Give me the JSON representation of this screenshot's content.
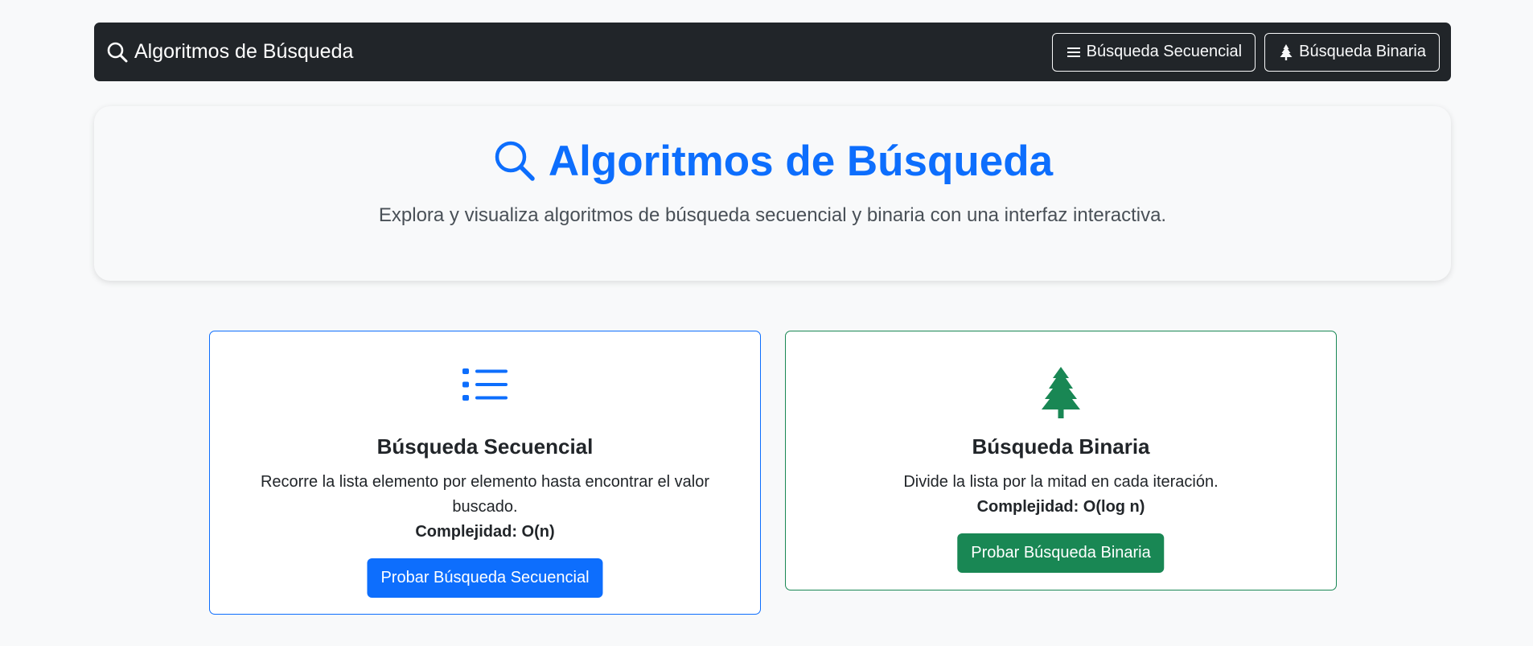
{
  "navbar": {
    "brand_icon": "search-icon",
    "brand": "Algoritmos de Búsqueda",
    "buttons": [
      {
        "icon": "list-icon",
        "label": "Búsqueda Secuencial"
      },
      {
        "icon": "tree-icon",
        "label": "Búsqueda Binaria"
      }
    ]
  },
  "hero": {
    "icon": "search-icon",
    "title": "Algoritmos de Búsqueda",
    "subtitle": "Explora y visualiza algoritmos de búsqueda secuencial y binaria con una interfaz interactiva."
  },
  "cards": [
    {
      "icon": "list-icon",
      "title": "Búsqueda Secuencial",
      "description": "Recorre la lista elemento por elemento hasta encontrar el valor buscado.",
      "complexity": "Complejidad: O(n)",
      "button": "Probar Búsqueda Secuencial",
      "color": "#0d6efd"
    },
    {
      "icon": "tree-icon",
      "title": "Búsqueda Binaria",
      "description": "Divide la lista por la mitad en cada iteración.",
      "complexity": "Complejidad: O(log n)",
      "button": "Probar Búsqueda Binaria",
      "color": "#198754"
    }
  ],
  "colors": {
    "primary": "#0d6efd",
    "success": "#198754",
    "dark": "#212529",
    "light": "#f8f9fa"
  }
}
